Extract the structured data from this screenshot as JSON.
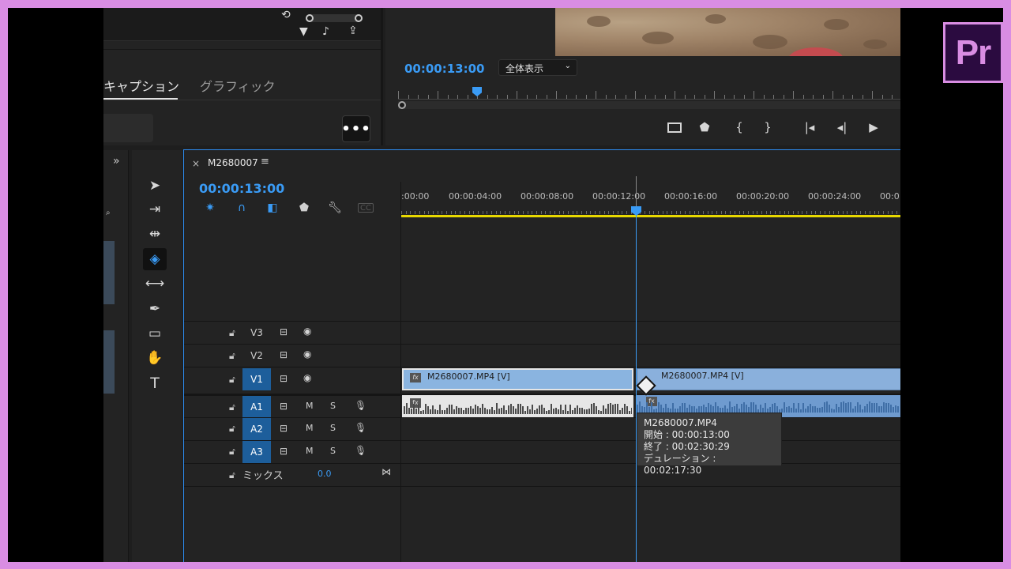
{
  "app": {
    "logo_text": "Pr",
    "accent": "#3a9bf5",
    "border_color": "#d98de3"
  },
  "top_left_panel": {
    "tab_captions": "キャプション",
    "tab_graphics": "グラフィック",
    "more_button": "•••",
    "icons": [
      "reset-icon",
      "filter-icon",
      "audio-icon",
      "export-icon"
    ]
  },
  "program_monitor": {
    "timecode": "00:00:13:00",
    "zoom_select": "全体表示",
    "transport_icons": [
      "safe-margins-icon",
      "add-marker-icon",
      "mark-in-icon",
      "mark-out-icon",
      "go-to-in-icon",
      "step-back-icon",
      "play-icon"
    ]
  },
  "tools": [
    "selection-tool",
    "track-select-tool",
    "ripple-edit-tool",
    "razor-tool",
    "slip-tool",
    "pen-tool",
    "rectangle-tool",
    "hand-tool",
    "type-tool"
  ],
  "timeline": {
    "sequence_name": "M2680007",
    "timecode": "00:00:13:00",
    "ruler_labels": [
      ":00:00",
      "00:00:04:00",
      "00:00:08:00",
      "00:00:12:00",
      "00:00:16:00",
      "00:00:20:00",
      "00:00:24:00",
      "00:0"
    ],
    "tracks": {
      "video": [
        "V3",
        "V2",
        "V1"
      ],
      "audio": [
        "A1",
        "A2",
        "A3"
      ],
      "audio_buttons": {
        "mute": "M",
        "solo": "S"
      },
      "mix_label": "ミックス",
      "mix_value": "0.0"
    },
    "clips": {
      "v1_left": "M2680007.MP4 [V]",
      "v1_right": "M2680007.MP4 [V]",
      "fx": "fx"
    },
    "tooltip": {
      "name": "M2680007.MP4",
      "start": "開始 : 00:00:13:00",
      "end": "終了 : 00:02:30:29",
      "duration": "デュレーション : 00:02:17:30"
    },
    "colors": {
      "video_clip": "#8ab0dc",
      "audio_clip": "#6f9bcf",
      "work_area": "#e8d800",
      "selected_track": "#1d5e9b"
    }
  }
}
